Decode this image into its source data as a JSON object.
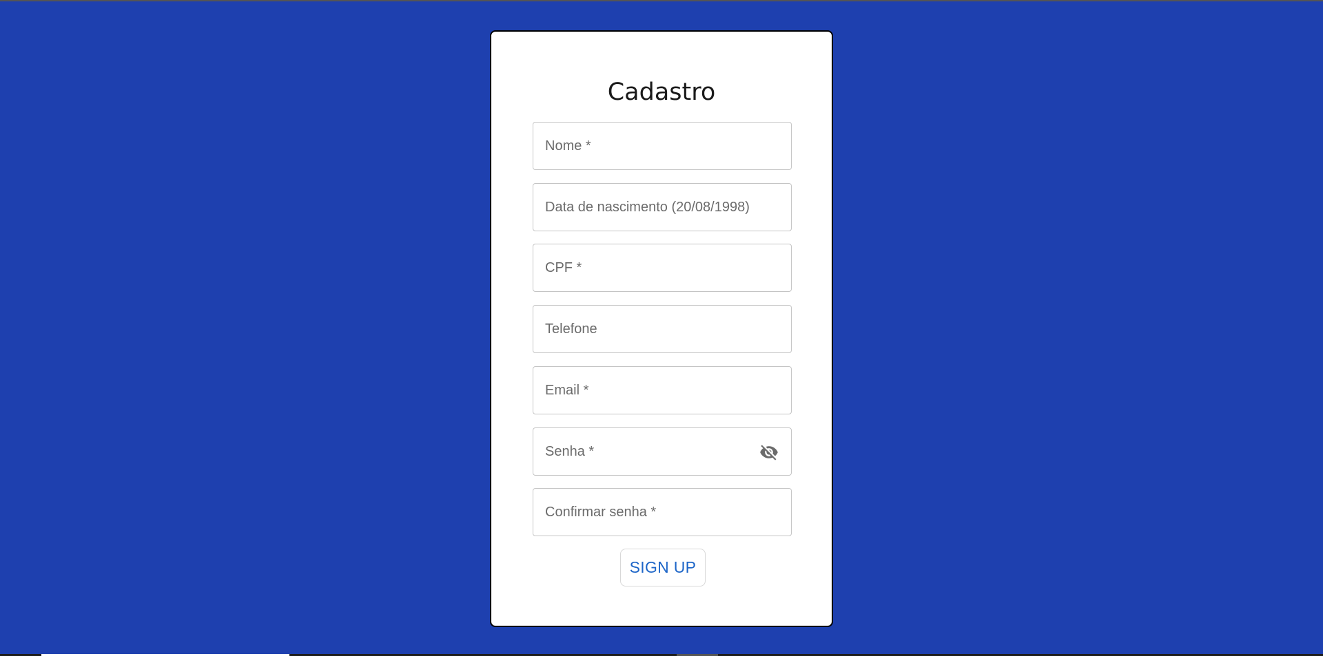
{
  "form": {
    "title": "Cadastro",
    "fields": [
      {
        "name": "nome",
        "placeholder": "Nome *",
        "value": ""
      },
      {
        "name": "data-nascimento",
        "placeholder": "Data de nascimento (20/08/1998) *",
        "value": ""
      },
      {
        "name": "cpf",
        "placeholder": "CPF *",
        "value": ""
      },
      {
        "name": "telefone",
        "placeholder": "Telefone",
        "value": ""
      },
      {
        "name": "email",
        "placeholder": "Email *",
        "value": ""
      },
      {
        "name": "senha",
        "placeholder": "Senha *",
        "value": ""
      },
      {
        "name": "confirmar-senha",
        "placeholder": "Confirmar senha *",
        "value": ""
      }
    ],
    "password_toggle_icon": "eye-off-icon",
    "submit_label": "SIGN UP"
  },
  "colors": {
    "background": "#1e40af",
    "card": "#ffffff",
    "accent": "#1e66c8",
    "icon": "#6b6b6b"
  }
}
